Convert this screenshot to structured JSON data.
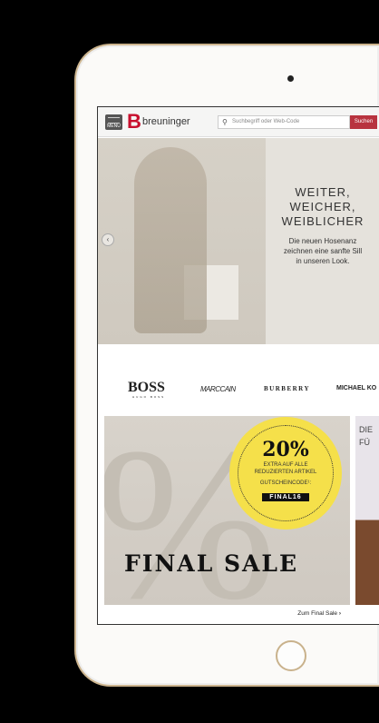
{
  "header": {
    "menu_label": "MENU",
    "logo": "breuninger",
    "search_placeholder": "Suchbegriff oder Web-Code",
    "search_button": "Suchen"
  },
  "hero": {
    "headline": [
      "WEITER,",
      "WEICHER,",
      "WEIBLICHER"
    ],
    "sub": [
      "Die neuen Hosenanz",
      "zeichnen eine sanfte Sill",
      "in unseren Look."
    ]
  },
  "brands": [
    "BOSS",
    "HUGO BOSS",
    "MARCCAIN",
    "BURBERRY",
    "MICHAEL KO"
  ],
  "promo": {
    "percent": "20%",
    "line1": "EXTRA AUF ALLE",
    "line2": "REDUZIERTEN ARTIKEL",
    "code_label": "GUTSCHEINCODE¹:",
    "code": "FINAL16",
    "title": "FINAL SALE",
    "link": "Zum Final Sale",
    "link_arrow": "›"
  },
  "promo2": {
    "text": [
      "DIE",
      "FÜ"
    ]
  }
}
